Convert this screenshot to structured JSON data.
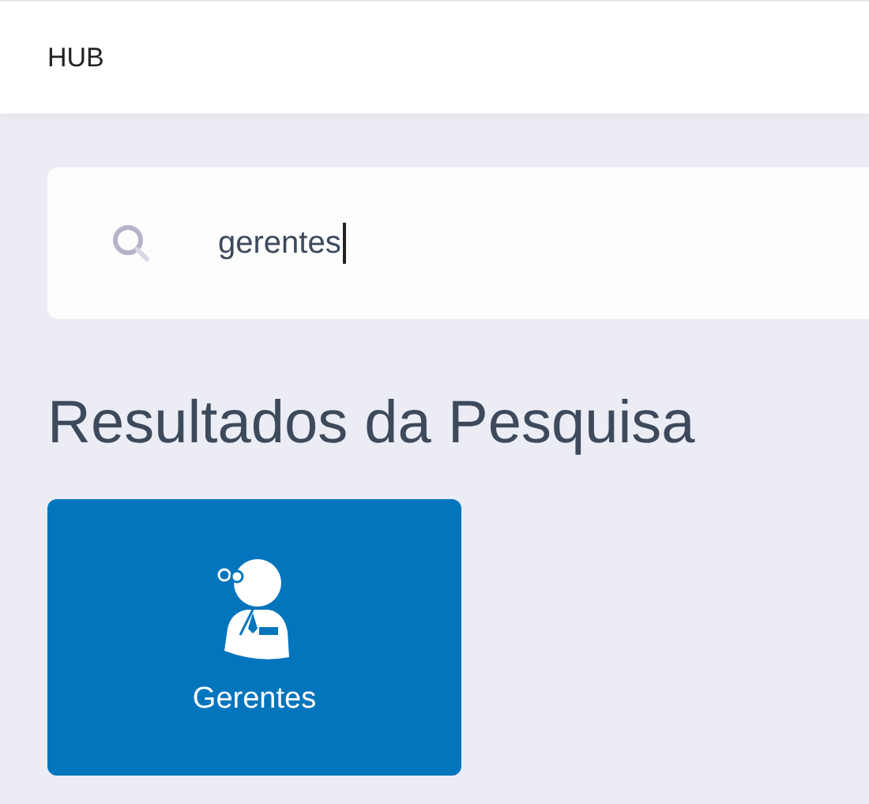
{
  "header": {
    "title": "HUB"
  },
  "search": {
    "value": "gerentes"
  },
  "results": {
    "heading": "Resultados da Pesquisa",
    "items": [
      {
        "label": "Gerentes"
      }
    ]
  }
}
